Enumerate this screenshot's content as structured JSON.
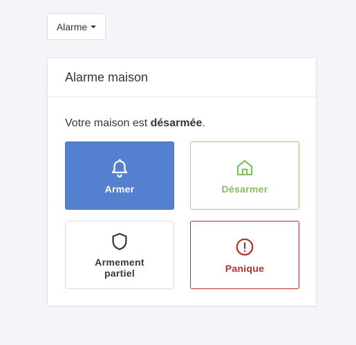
{
  "menu": {
    "label": "Alarme",
    "icon": "caret-down-icon"
  },
  "panel": {
    "title": "Alarme maison",
    "status_prefix": "Votre maison est ",
    "status_value": "désarmée",
    "status_suffix": "."
  },
  "actions": [
    {
      "label": "Armer",
      "icon": "bell-icon",
      "color": "#5380cf",
      "style": "filled"
    },
    {
      "label": "Désarmer",
      "icon": "home-icon",
      "color": "#86bd60",
      "style": "outline"
    },
    {
      "label": "Armement partiel",
      "icon": "shield-icon",
      "color": "#33363b",
      "style": "outline"
    },
    {
      "label": "Panique",
      "icon": "alert-circle-icon",
      "color": "#b5302d",
      "style": "outline"
    }
  ]
}
